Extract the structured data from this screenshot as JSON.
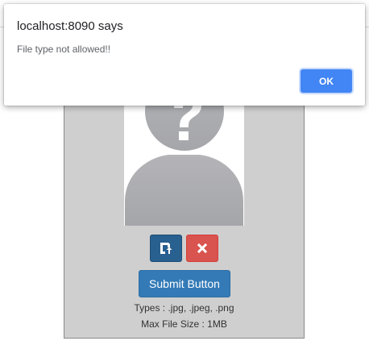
{
  "dialog": {
    "title": "localhost:8090 says",
    "message": "File type not allowed!!",
    "ok_label": "OK",
    "accent_color": "#4285f4"
  },
  "upload": {
    "avatar_icon": "unknown-user-placeholder",
    "upload_icon": "upload-icon",
    "remove_icon": "close-icon",
    "submit_label": "Submit Button",
    "types_text": "Types : .jpg, .jpeg, .png",
    "size_text": "Max File Size : 1MB",
    "colors": {
      "primary": "#286090",
      "danger": "#d9534f",
      "submit": "#337ab7",
      "panel": "#cfcfcf"
    }
  }
}
